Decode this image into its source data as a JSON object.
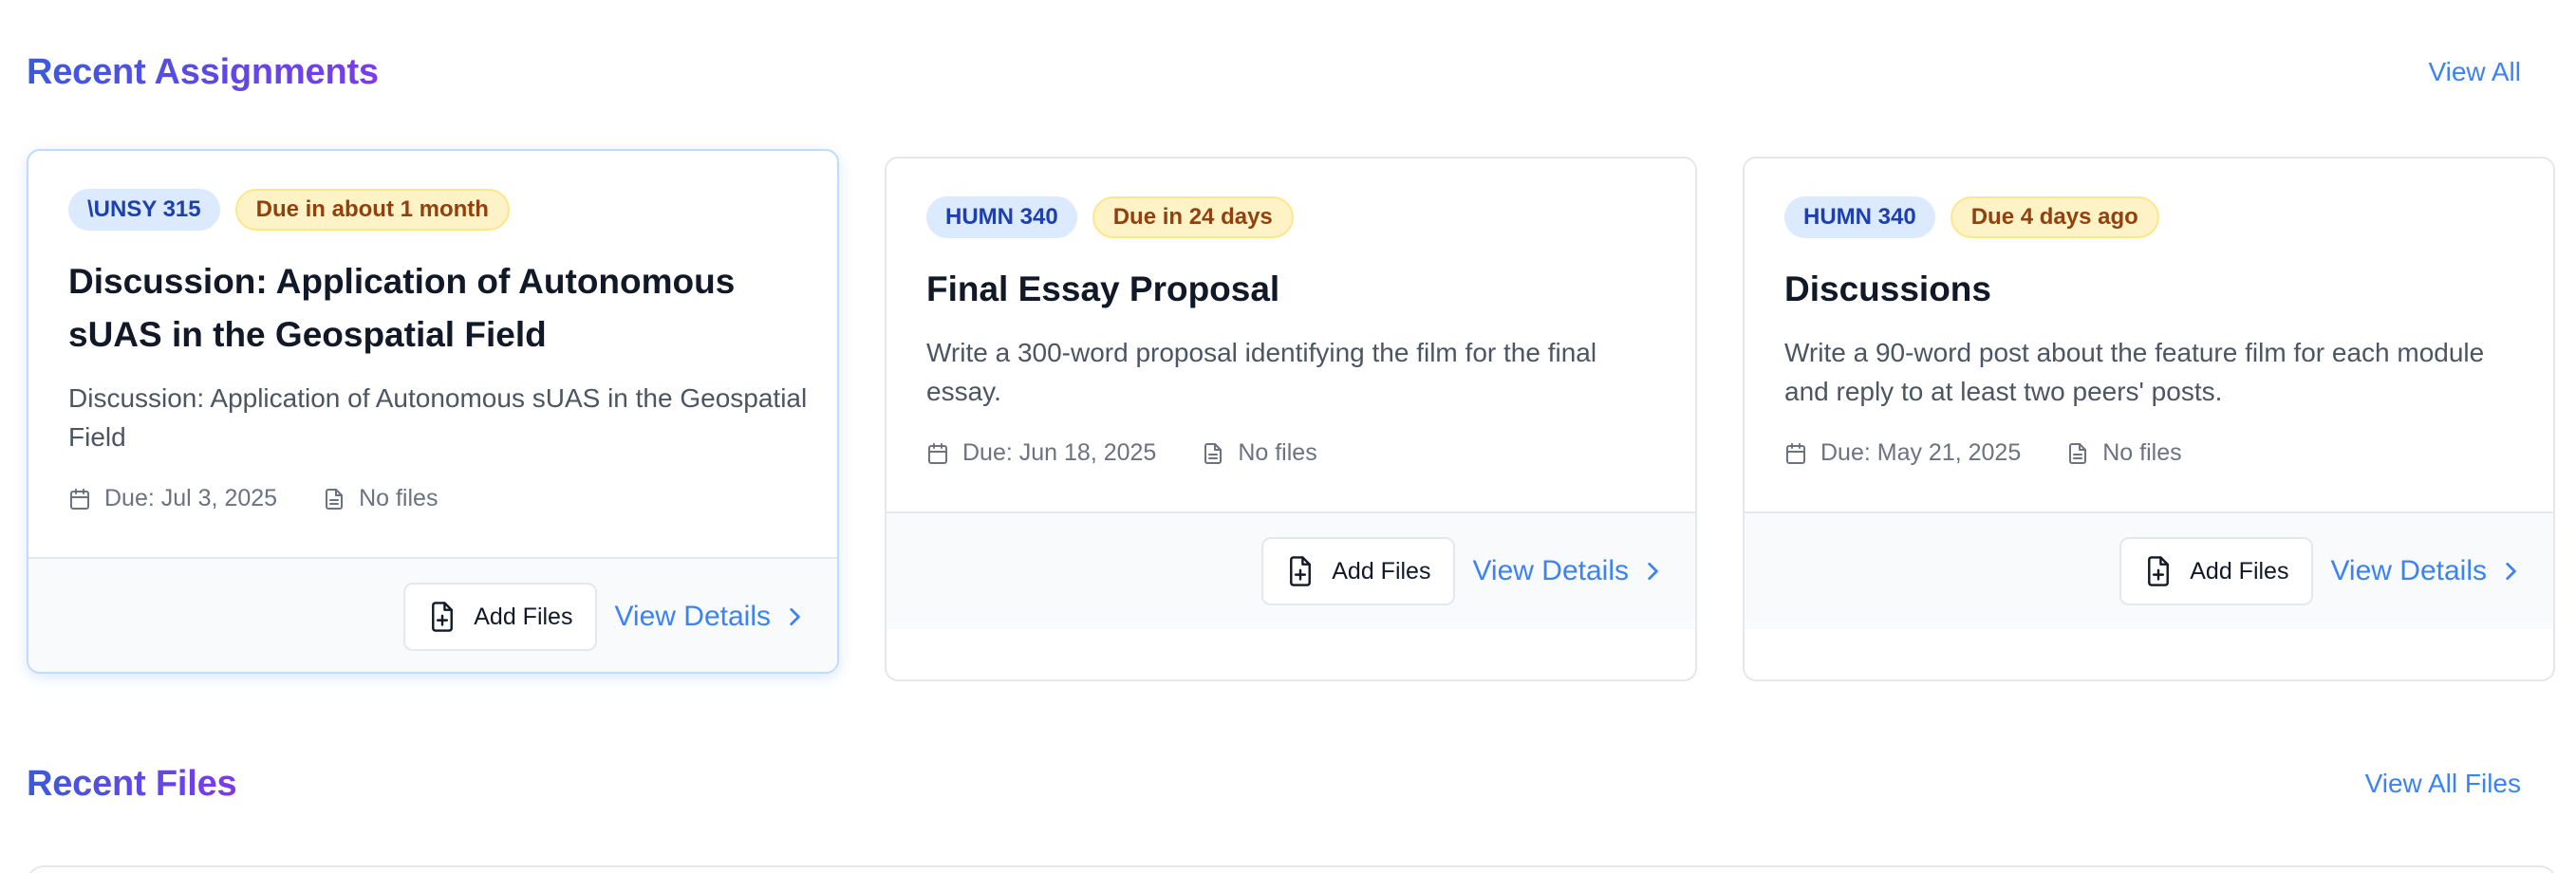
{
  "assignments_section": {
    "title": "Recent Assignments",
    "view_all_label": "View All"
  },
  "files_section": {
    "title": "Recent Files",
    "view_all_label": "View All Files"
  },
  "assignments": [
    {
      "course": "\\UNSY 315",
      "due_badge": "Due in about 1 month",
      "title": "Discussion: Application of Autonomous sUAS in the Geospatial Field",
      "description": "Discussion: Application of Autonomous sUAS in the Geospatial Field",
      "due_date": "Due: Jul 3, 2025",
      "files": "No files",
      "add_files_label": "Add Files",
      "view_details_label": "View Details"
    },
    {
      "course": "HUMN 340",
      "due_badge": "Due in 24 days",
      "title": "Final Essay Proposal",
      "description": "Write a 300-word proposal identifying the film for the final essay.",
      "due_date": "Due: Jun 18, 2025",
      "files": "No files",
      "add_files_label": "Add Files",
      "view_details_label": "View Details"
    },
    {
      "course": "HUMN 340",
      "due_badge": "Due 4 days ago",
      "title": "Discussions",
      "description": "Write a 90-word post about the feature film for each module and reply to at least two peers' posts.",
      "due_date": "Due: May 21, 2025",
      "files": "No files",
      "add_files_label": "Add Files",
      "view_details_label": "View Details"
    }
  ],
  "icons": {
    "calendar": "calendar-icon",
    "file": "file-icon",
    "file_plus": "file-plus-icon",
    "chevron_right": "chevron-right-icon"
  },
  "colors": {
    "accent": "#3b82f6",
    "title_gradient_start": "#3b5bdb",
    "title_gradient_end": "#7c3aed",
    "course_badge_bg": "#dbeafe",
    "due_badge_bg": "#fef3c7"
  }
}
